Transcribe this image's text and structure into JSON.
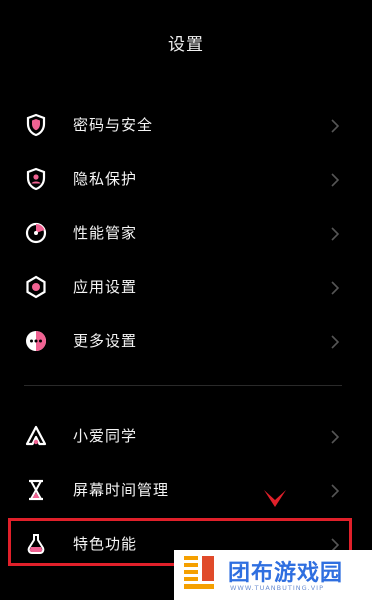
{
  "header": {
    "title": "设置"
  },
  "menu_groups": [
    {
      "items": [
        {
          "label": "密码与安全",
          "icon": "shield-lock-icon"
        },
        {
          "label": "隐私保护",
          "icon": "privacy-person-icon"
        },
        {
          "label": "性能管家",
          "icon": "performance-gauge-icon"
        },
        {
          "label": "应用设置",
          "icon": "hexagon-gear-icon"
        },
        {
          "label": "更多设置",
          "icon": "more-dots-icon"
        }
      ]
    },
    {
      "items": [
        {
          "label": "小爱同学",
          "icon": "xiaoai-assistant-icon"
        },
        {
          "label": "屏幕时间管理",
          "icon": "hourglass-icon"
        },
        {
          "label": "特色功能",
          "icon": "flask-icon"
        }
      ]
    }
  ],
  "annotation": {
    "highlighted_item": "特色功能",
    "color": "#e0202a"
  },
  "watermark": {
    "name": "团布游戏园",
    "url": "WWW.TUANBUTING.VIP"
  },
  "colors": {
    "background": "#000000",
    "icon_accent": "#f06292",
    "watermark_blue": "#2f6fe0"
  }
}
